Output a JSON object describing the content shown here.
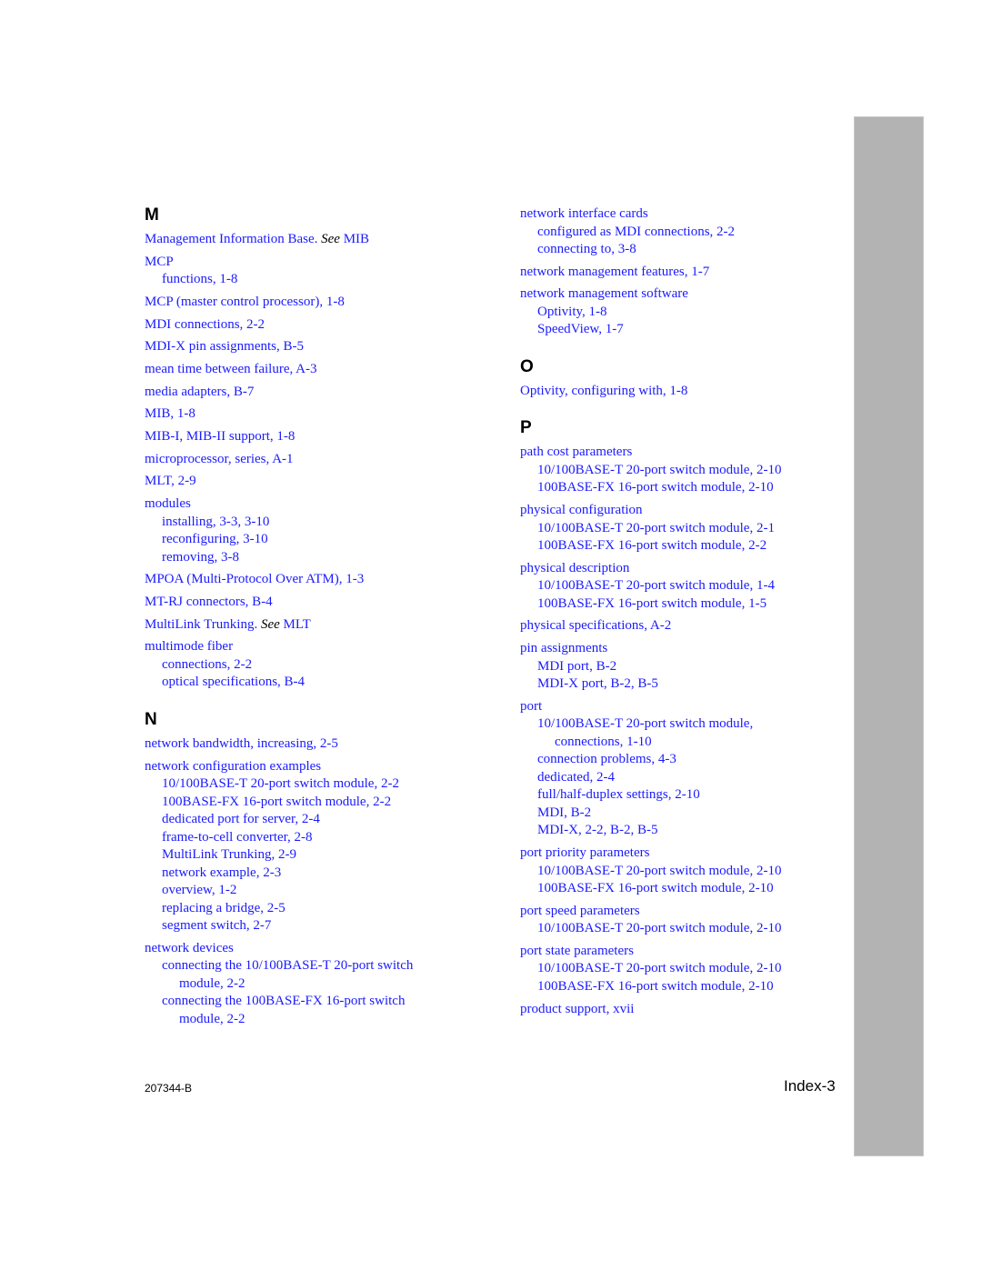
{
  "index": {
    "left_column": [
      {
        "letter": "M",
        "entries": [
          {
            "lines": [
              {
                "text": "Management Information Base. ",
                "see": "See",
                "after": " MIB",
                "level": 0
              }
            ]
          },
          {
            "lines": [
              {
                "text": "MCP",
                "level": 0
              },
              {
                "text": "functions, 1-8",
                "level": 1
              }
            ]
          },
          {
            "lines": [
              {
                "text": "MCP (master control processor), 1-8",
                "level": 0
              }
            ]
          },
          {
            "lines": [
              {
                "text": "MDI connections, 2-2",
                "level": 0
              }
            ]
          },
          {
            "lines": [
              {
                "text": "MDI-X pin assignments, B-5",
                "level": 0
              }
            ]
          },
          {
            "lines": [
              {
                "text": "mean time between failure, A-3",
                "level": 0
              }
            ]
          },
          {
            "lines": [
              {
                "text": "media adapters, B-7",
                "level": 0
              }
            ]
          },
          {
            "lines": [
              {
                "text": "MIB, 1-8",
                "level": 0
              }
            ]
          },
          {
            "lines": [
              {
                "text": "MIB-I, MIB-II support, 1-8",
                "level": 0
              }
            ]
          },
          {
            "lines": [
              {
                "text": "microprocessor, series, A-1",
                "level": 0
              }
            ]
          },
          {
            "lines": [
              {
                "text": "MLT, 2-9",
                "level": 0
              }
            ]
          },
          {
            "lines": [
              {
                "text": "modules",
                "level": 0
              },
              {
                "text": "installing, 3-3, 3-10",
                "level": 1
              },
              {
                "text": "reconfiguring, 3-10",
                "level": 1
              },
              {
                "text": "removing, 3-8",
                "level": 1
              }
            ]
          },
          {
            "lines": [
              {
                "text": "MPOA (Multi-Protocol Over ATM), 1-3",
                "level": 0
              }
            ]
          },
          {
            "lines": [
              {
                "text": "MT-RJ connectors, B-4",
                "level": 0
              }
            ]
          },
          {
            "lines": [
              {
                "text": "MultiLink Trunking. ",
                "see": "See",
                "after": " MLT",
                "level": 0
              }
            ]
          },
          {
            "lines": [
              {
                "text": "multimode fiber",
                "level": 0
              },
              {
                "text": "connections, 2-2",
                "level": 1
              },
              {
                "text": "optical specifications, B-4",
                "level": 1
              }
            ]
          }
        ]
      },
      {
        "letter": "N",
        "entries": [
          {
            "lines": [
              {
                "text": "network bandwidth, increasing, 2-5",
                "level": 0
              }
            ]
          },
          {
            "lines": [
              {
                "text": "network configuration examples",
                "level": 0
              },
              {
                "text": "10/100BASE-T 20-port switch module, 2-2",
                "level": 1
              },
              {
                "text": "100BASE-FX 16-port switch module, 2-2",
                "level": 1
              },
              {
                "text": "dedicated port for server, 2-4",
                "level": 1
              },
              {
                "text": "frame-to-cell converter, 2-8",
                "level": 1
              },
              {
                "text": "MultiLink Trunking, 2-9",
                "level": 1
              },
              {
                "text": "network example, 2-3",
                "level": 1
              },
              {
                "text": "overview, 1-2",
                "level": 1
              },
              {
                "text": "replacing a bridge, 2-5",
                "level": 1
              },
              {
                "text": "segment switch, 2-7",
                "level": 1
              }
            ]
          },
          {
            "lines": [
              {
                "text": "network devices",
                "level": 0
              },
              {
                "text": "connecting the 10/100BASE-T 20-port switch",
                "level": 1
              },
              {
                "text": "module, 2-2",
                "level": 2
              },
              {
                "text": "connecting the 100BASE-FX 16-port switch",
                "level": 1
              },
              {
                "text": "module, 2-2",
                "level": 2
              }
            ]
          }
        ]
      }
    ],
    "right_column": [
      {
        "letter": "",
        "entries": [
          {
            "lines": [
              {
                "text": "network interface cards",
                "level": 0
              },
              {
                "text": "configured as MDI connections, 2-2",
                "level": 1
              },
              {
                "text": "connecting to, 3-8",
                "level": 1
              }
            ]
          },
          {
            "lines": [
              {
                "text": "network management features, 1-7",
                "level": 0
              }
            ]
          },
          {
            "lines": [
              {
                "text": "network management software",
                "level": 0
              },
              {
                "text": "Optivity, 1-8",
                "level": 1
              },
              {
                "text": "SpeedView, 1-7",
                "level": 1
              }
            ]
          }
        ]
      },
      {
        "letter": "O",
        "entries": [
          {
            "lines": [
              {
                "text": "Optivity, configuring with, 1-8",
                "level": 0
              }
            ]
          }
        ]
      },
      {
        "letter": "P",
        "entries": [
          {
            "lines": [
              {
                "text": "path cost parameters",
                "level": 0
              },
              {
                "text": "10/100BASE-T 20-port switch module, 2-10",
                "level": 1
              },
              {
                "text": "100BASE-FX 16-port switch module, 2-10",
                "level": 1
              }
            ]
          },
          {
            "lines": [
              {
                "text": "physical configuration",
                "level": 0
              },
              {
                "text": "10/100BASE-T 20-port switch module, 2-1",
                "level": 1
              },
              {
                "text": "100BASE-FX 16-port switch module, 2-2",
                "level": 1
              }
            ]
          },
          {
            "lines": [
              {
                "text": "physical description",
                "level": 0
              },
              {
                "text": "10/100BASE-T 20-port switch module, 1-4",
                "level": 1
              },
              {
                "text": "100BASE-FX 16-port switch module, 1-5",
                "level": 1
              }
            ]
          },
          {
            "lines": [
              {
                "text": "physical specifications, A-2",
                "level": 0
              }
            ]
          },
          {
            "lines": [
              {
                "text": "pin assignments",
                "level": 0
              },
              {
                "text": "MDI port, B-2",
                "level": 1
              },
              {
                "text": "MDI-X port, B-2, B-5",
                "level": 1
              }
            ]
          },
          {
            "lines": [
              {
                "text": "port",
                "level": 0
              },
              {
                "text": "10/100BASE-T 20-port switch module,",
                "level": 1
              },
              {
                "text": "connections, 1-10",
                "level": 2
              },
              {
                "text": "connection problems, 4-3",
                "level": 1
              },
              {
                "text": "dedicated, 2-4",
                "level": 1
              },
              {
                "text": "full/half-duplex settings, 2-10",
                "level": 1
              },
              {
                "text": "MDI, B-2",
                "level": 1
              },
              {
                "text": "MDI-X, 2-2, B-2, B-5",
                "level": 1
              }
            ]
          },
          {
            "lines": [
              {
                "text": "port priority parameters",
                "level": 0
              },
              {
                "text": "10/100BASE-T 20-port switch module, 2-10",
                "level": 1
              },
              {
                "text": "100BASE-FX 16-port switch module, 2-10",
                "level": 1
              }
            ]
          },
          {
            "lines": [
              {
                "text": "port speed parameters",
                "level": 0
              },
              {
                "text": "10/100BASE-T 20-port switch module, 2-10",
                "level": 1
              }
            ]
          },
          {
            "lines": [
              {
                "text": "port state parameters",
                "level": 0
              },
              {
                "text": "10/100BASE-T 20-port switch module, 2-10",
                "level": 1
              },
              {
                "text": "100BASE-FX 16-port switch module, 2-10",
                "level": 1
              }
            ]
          },
          {
            "lines": [
              {
                "text": "product support, xvii",
                "level": 0
              }
            ]
          }
        ]
      }
    ]
  },
  "footer": {
    "doc_number": "207344-B",
    "page_label": "Index-3"
  },
  "colors": {
    "link": "#1a1aff",
    "heading": "#000000",
    "thumb_tab": "#b3b3b3"
  }
}
